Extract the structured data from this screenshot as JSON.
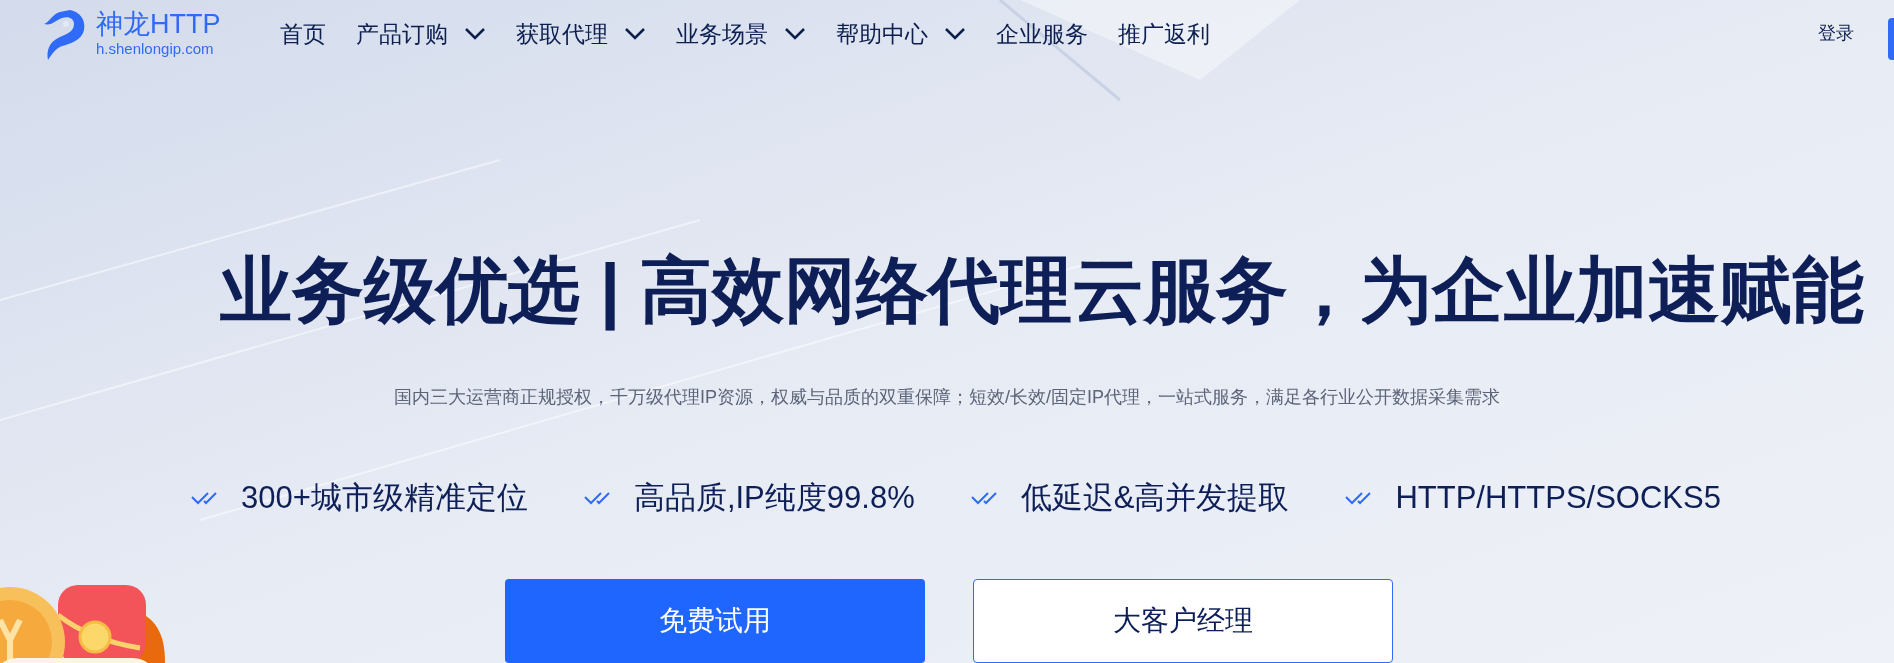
{
  "brand": {
    "name": "神龙HTTP",
    "domain": "h.shenlongip.com"
  },
  "nav": [
    {
      "label": "首页",
      "kind": "link"
    },
    {
      "label": "产品订购",
      "kind": "dropdown"
    },
    {
      "label": "获取代理",
      "kind": "dropdown"
    },
    {
      "label": "业务场景",
      "kind": "dropdown"
    },
    {
      "label": "帮助中心",
      "kind": "dropdown"
    },
    {
      "label": "企业服务",
      "kind": "link"
    },
    {
      "label": "推广返利",
      "kind": "link"
    }
  ],
  "login": "登录",
  "hero": {
    "title": "业务级优选 | 高效网络代理云服务，为企业加速赋能",
    "subtitle": "国内三大运营商正规授权，千万级代理IP资源，权威与品质的双重保障；短效/长效/固定IP代理，一站式服务，满足各行业公开数据采集需求"
  },
  "features": [
    "300+城市级精准定位",
    "高品质,IP纯度99.8%",
    "低延迟&高并发提取",
    "HTTP/HTTPS/SOCKS5"
  ],
  "buttons": [
    {
      "label": "免费试用",
      "kind": "primary"
    },
    {
      "label": "大客户经理",
      "kind": "secondary"
    }
  ]
}
